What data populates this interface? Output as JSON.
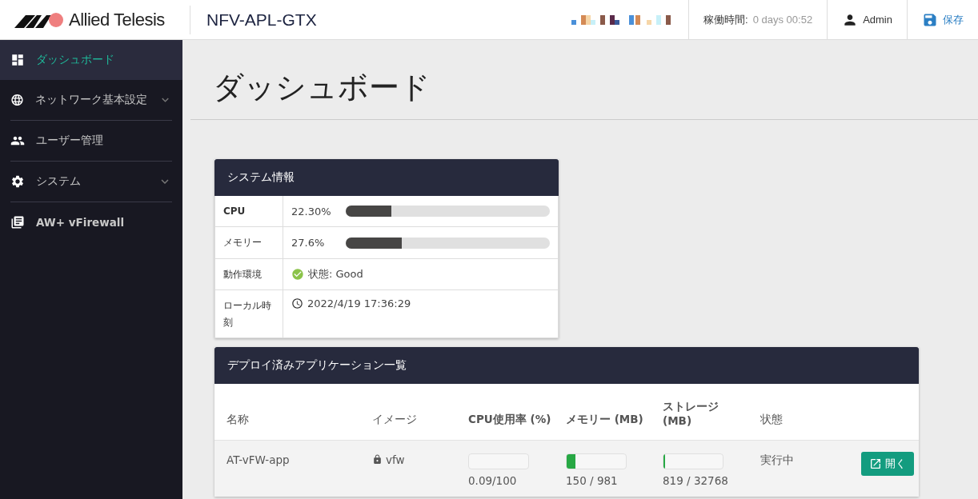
{
  "header": {
    "brand": "Allied Telesis",
    "device": "NFV-APL-GTX",
    "uptime_label": "稼働時間:",
    "uptime_value": "0 days 00:52",
    "user": "Admin",
    "save": "保存"
  },
  "sidebar": {
    "items": [
      {
        "label": "ダッシュボード",
        "selected": true,
        "expandable": false
      },
      {
        "label": "ネットワーク基本設定",
        "selected": false,
        "expandable": true
      },
      {
        "label": "ユーザー管理",
        "selected": false,
        "expandable": false
      },
      {
        "label": "システム",
        "selected": false,
        "expandable": true
      },
      {
        "label": "AW+ vFirewall",
        "selected": false,
        "expandable": false
      }
    ]
  },
  "page_title": "ダッシュボード",
  "system_info": {
    "title": "システム情報",
    "rows": [
      {
        "kind": "meter",
        "label": "CPU",
        "value": "22.30%",
        "level": 0.223
      },
      {
        "kind": "meter",
        "label": "メモリー",
        "value": "27.6%",
        "level": 0.276
      },
      {
        "kind": "status",
        "label": "動作環境",
        "value": "状態: Good"
      },
      {
        "kind": "clock",
        "label": "ローカル時刻",
        "value": "2022/4/19 17:36:29"
      }
    ]
  },
  "apps": {
    "title": "デプロイ済みアプリケーション一覧",
    "columns": [
      "名称",
      "イメージ",
      "CPU使用率 (%)",
      "メモリー (MB)",
      "ストレージ (MB)",
      "状態"
    ],
    "rows": [
      {
        "name": "AT-vFW-app",
        "image": "vfw",
        "cpu": {
          "text": "0.09/100",
          "level": 0.0009
        },
        "memory": {
          "text": "150 / 981",
          "level": 0.153
        },
        "storage": {
          "text": "819 / 32768",
          "level": 0.025
        },
        "state": "実行中",
        "action": "開く"
      }
    ]
  }
}
